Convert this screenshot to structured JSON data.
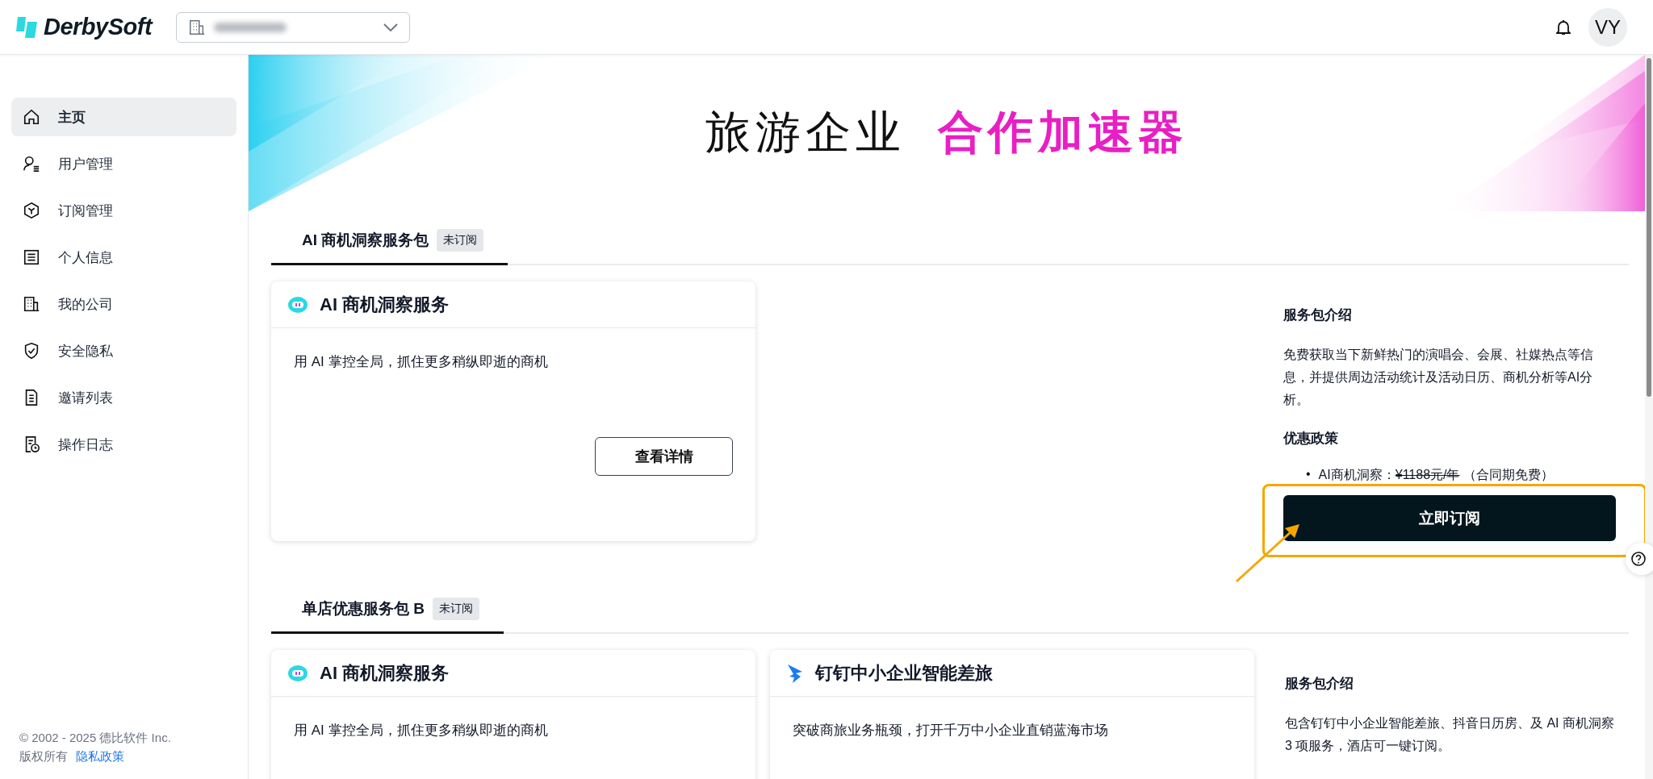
{
  "header": {
    "logo": "DerbySoft",
    "avatar": "VY"
  },
  "sidebar": {
    "items": [
      {
        "kind": "home",
        "label": "主页",
        "selected": true
      },
      {
        "kind": "user",
        "label": "用户管理",
        "selected": false
      },
      {
        "kind": "box",
        "label": "订阅管理",
        "selected": false
      },
      {
        "kind": "card",
        "label": "个人信息",
        "selected": false
      },
      {
        "kind": "building",
        "label": "我的公司",
        "selected": false
      },
      {
        "kind": "shield",
        "label": "安全隐私",
        "selected": false
      },
      {
        "kind": "list",
        "label": "邀请列表",
        "selected": false
      },
      {
        "kind": "log",
        "label": "操作日志",
        "selected": false
      }
    ],
    "footer": {
      "copyright": "© 2002 - 2025 德比软件 Inc.",
      "rights": "版权所有",
      "link": "隐私政策"
    }
  },
  "banner": {
    "title": "旅游企业",
    "highlight": "合作加速器"
  },
  "packages": [
    {
      "tab": {
        "label": "AI 商机洞察服务包",
        "badge": "未订阅",
        "selected": true
      },
      "cards": [
        {
          "kind": "robot",
          "title": "AI 商机洞察服务",
          "description": "用 AI 掌控全局，抓住更多稍纵即逝的商机",
          "button": "查看详情"
        }
      ],
      "intro": {
        "heading": "服务包介绍",
        "text": "免费获取当下新鲜热门的演唱会、会展、社媒热点等信息，并提供周边活动统计及活动日历、商机分析等AI分析。",
        "offer_heading": "优惠政策",
        "offers": [
          {
            "marker": "•",
            "label": "AI商机洞察：",
            "old_price": "¥1188元/年",
            "note": "（合同期免费）"
          }
        ],
        "button": "立即订阅",
        "highlighted": true
      }
    },
    {
      "tab": {
        "label": "单店优惠服务包 B",
        "badge": "未订阅",
        "selected": true
      },
      "cards": [
        {
          "kind": "robot",
          "title": "AI 商机洞察服务",
          "description": "用 AI 掌控全局，抓住更多稍纵即逝的商机"
        },
        {
          "kind": "bird",
          "title": "钉钉中小企业智能差旅",
          "description": "突破商旅业务瓶颈，打开千万中小企业直销蓝海市场"
        }
      ],
      "intro": {
        "heading": "服务包介绍",
        "text": "包含钉钉中小企业智能差旅、抖音日历房、及 AI 商机洞察 3 项服务，酒店可一键订阅。"
      }
    }
  ]
}
